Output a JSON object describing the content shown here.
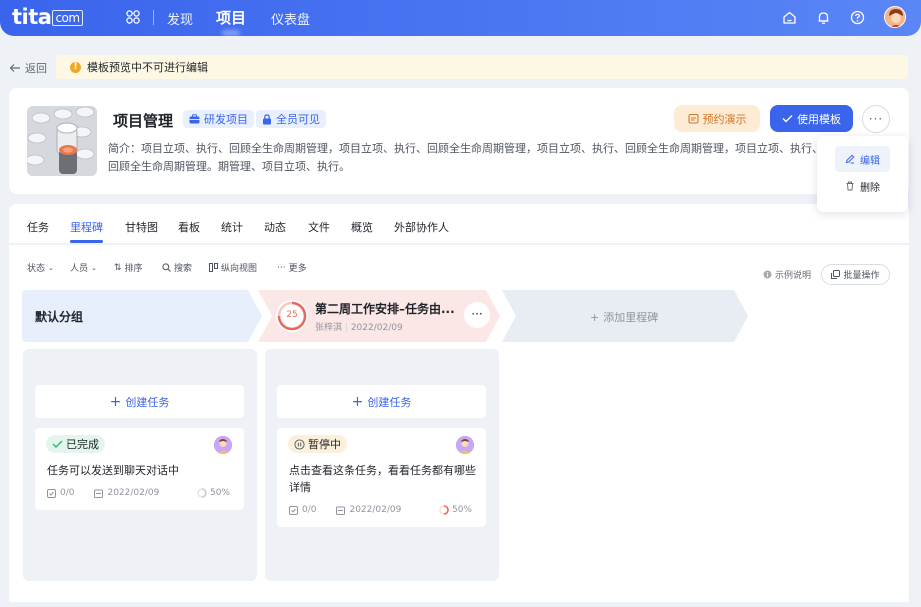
{
  "nav": {
    "logo_text": "tita",
    "logo_suffix": "com",
    "items": [
      "发现",
      "项目",
      "仪表盘"
    ],
    "active_item": "项目"
  },
  "notice": {
    "back_label": "返回",
    "text": "模板预览中不可进行编辑"
  },
  "project": {
    "title": "项目管理",
    "tags": [
      "研发项目",
      "全员可见"
    ],
    "description": "简介：项目立项、执行、回顾全生命周期管理，项目立项、执行、回顾全生命周期管理，项目立项、执行、回顾全生命周期管理，项目立项、执行、回顾全生命周期管理。期管理、项目立项、执行。",
    "demo_button": "预约演示",
    "use_button": "使用模板"
  },
  "dropdown": {
    "items": [
      "编辑",
      "删除"
    ],
    "selected": "编辑"
  },
  "tabs": [
    "任务",
    "里程碑",
    "甘特图",
    "看板",
    "统计",
    "动态",
    "文件",
    "概览",
    "外部协作人"
  ],
  "active_tab": "里程碑",
  "toolbar": {
    "items": [
      "状态",
      "人员",
      "排序",
      "搜索",
      "纵向视图",
      "更多"
    ],
    "hint": "示例说明",
    "batch": "批量操作"
  },
  "board": {
    "default_group": "默认分组",
    "milestone": {
      "badge": "25",
      "title": "第二周工作安排–任务由...",
      "owner": "张梓淇",
      "date": "2022/02/09"
    },
    "add_milestone": "添加里程碑",
    "create_task": "创建任务",
    "columns": [
      {
        "task": {
          "status": "已完成",
          "title": "任务可以发送到聊天对话中",
          "subtasks": "0/0",
          "date": "2022/02/09",
          "progress": "50%"
        }
      },
      {
        "task": {
          "status": "暂停中",
          "title": "点击查看这条任务，看看任务都有哪些详情",
          "subtasks": "0/0",
          "date": "2022/02/09",
          "progress": "50%"
        }
      }
    ]
  },
  "colors": {
    "primary": "#3a64ec",
    "done_bg": "#e3f6ec",
    "paused_bg": "#fdf0da",
    "milestone_red": "#e86a5c"
  },
  "icons": [
    "apps-icon",
    "home-icon",
    "bell-icon",
    "help-icon",
    "avatar",
    "back-arrow-icon",
    "info-icon",
    "briefcase-icon",
    "lock-icon",
    "calendar-icon",
    "check-icon",
    "more-icon",
    "edit-icon",
    "trash-icon",
    "plus-icon",
    "pause-icon"
  ]
}
